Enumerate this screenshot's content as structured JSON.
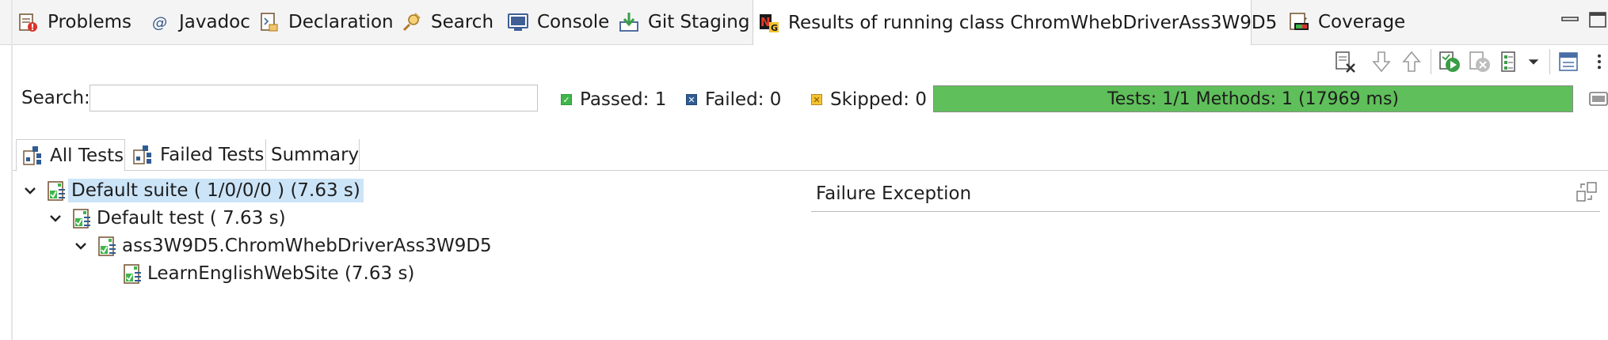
{
  "view_tabs": [
    {
      "label": "Problems",
      "icon": "problems-icon"
    },
    {
      "label": "Javadoc",
      "icon": "javadoc-icon"
    },
    {
      "label": "Declaration",
      "icon": "declaration-icon"
    },
    {
      "label": "Search",
      "icon": "search-icon"
    },
    {
      "label": "Console",
      "icon": "console-icon"
    },
    {
      "label": "Git Staging",
      "icon": "git-staging-icon"
    },
    {
      "label": "Results of running class ChromWhebDriverAss3W9D5",
      "icon": "testng-icon",
      "active": true
    },
    {
      "label": "Coverage",
      "icon": "coverage-icon"
    }
  ],
  "toolbar": {
    "icons": [
      "clear-results-icon",
      "next-failure-icon",
      "previous-failure-icon",
      "rerun-icon",
      "rerun-failed-icon",
      "history-icon",
      "view-menu-icon",
      "toggle-orientation-icon"
    ]
  },
  "search": {
    "label": "Search:",
    "value": "",
    "placeholder": ""
  },
  "stats": {
    "passed": "Passed: 1",
    "failed": "Failed: 0",
    "skipped": "Skipped: 0",
    "passed_color": "#2e9e3e",
    "failed_color": "#24466e",
    "skipped_color": "#d9a21a"
  },
  "progress": {
    "text": "Tests: 1/1  Methods: 1 (17969 ms)",
    "fraction": 1.0,
    "color": "#5fbf5a"
  },
  "sub_tabs": [
    {
      "label": "All Tests",
      "icon": "all-tests-icon",
      "active": true
    },
    {
      "label": "Failed Tests",
      "icon": "failed-tests-icon"
    },
    {
      "label": "Summary"
    }
  ],
  "tree": [
    {
      "label": "Default suite ( 1/0/0/0 ) (7.63 s)",
      "expanded": true,
      "selected": true
    },
    {
      "label": "Default test ( 7.63 s)",
      "expanded": true
    },
    {
      "label": "ass3W9D5.ChromWhebDriverAss3W9D5",
      "expanded": true
    },
    {
      "label": "LearnEnglishWebSite  (7.63 s)"
    }
  ],
  "failure_pane": {
    "title": "Failure Exception"
  },
  "colors": {
    "accent_selection": "#cce4f7",
    "pass_green": "#5fbf5a"
  }
}
